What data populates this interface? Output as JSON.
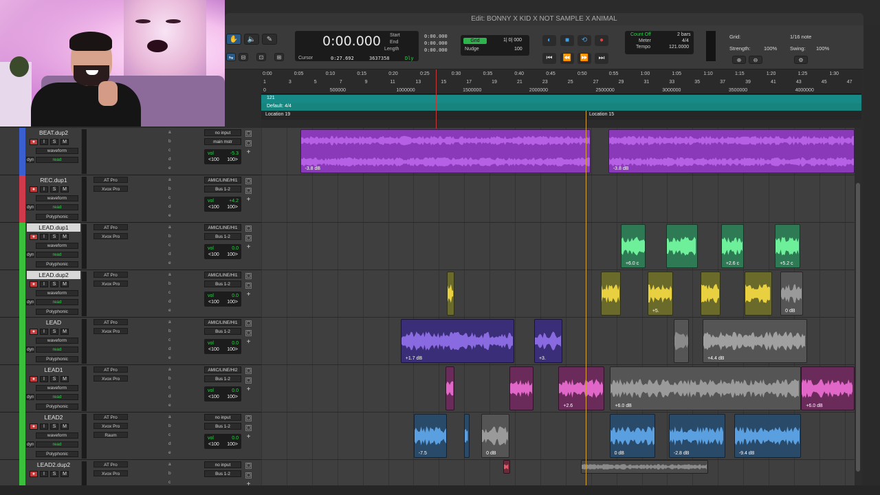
{
  "window": {
    "title": "Edit: BONNY X KID X NOT SAMPLE X ANIMAL"
  },
  "counter": {
    "main": "0:00.000",
    "cursor_label": "Cursor",
    "cursor_val": "0:27.692",
    "samples": "3637358",
    "dly": "Dly",
    "start_label": "Start",
    "end_label": "End",
    "length_label": "Length",
    "start": "0:00.000",
    "end": "0:00.000",
    "length": "0:00.000"
  },
  "grid_nudge": {
    "grid_label": "Grid",
    "grid_val": "1| 0| 000",
    "nudge_label": "Nudge",
    "nudge_val": "100"
  },
  "tempo": {
    "count_off": "Count Off",
    "meter_label": "Meter",
    "tempo_label": "Tempo",
    "bars": "2 bars",
    "meter": "4/4",
    "tempo": "121.0000"
  },
  "gridpanel": {
    "grid_label": "Grid:",
    "grid_val": "1/16 note",
    "strength_label": "Strength:",
    "strength": "100%",
    "swing_label": "Swing:",
    "swing": "100%"
  },
  "ruler": {
    "times": [
      "0:00",
      "0:05",
      "0:10",
      "0:15",
      "0:20",
      "0:25",
      "0:30",
      "0:35",
      "0:40",
      "0:45",
      "0:50",
      "0:55",
      "1:00",
      "1:05",
      "1:10",
      "1:15",
      "1:20",
      "1:25",
      "1:30"
    ],
    "bars": [
      "1",
      "3",
      "5",
      "7",
      "9",
      "11",
      "13",
      "15",
      "17",
      "19",
      "21",
      "23",
      "25",
      "27",
      "29",
      "31",
      "33",
      "35",
      "37",
      "39",
      "41",
      "43",
      "45",
      "47"
    ],
    "samples": [
      "0",
      "500000",
      "1000000",
      "1500000",
      "2000000",
      "2500000",
      "3000000",
      "3500000",
      "4000000"
    ],
    "tempo_marker": "121",
    "meter_marker": "Default: 4/4",
    "marker1": "Location 19",
    "marker2": "Location 15"
  },
  "tracks": [
    {
      "name": "BEAT.dup2",
      "color": "#3a5fd0",
      "in1": "",
      "in2": "",
      "io1": "no input",
      "io2": "main mstr",
      "vol": "-5.3",
      "pan1": "<100",
      "pan2": "100>",
      "mode": "waveform",
      "dyn": "dyn",
      "read": "read",
      "extra": ""
    },
    {
      "name": "REC.dup1",
      "color": "#d03a4a",
      "in1": "AT Pro",
      "in2": "Xvox Pro",
      "io1": "AMIC/LINE/HI1",
      "io2": "Bus 1-2",
      "vol": "+4.2",
      "pan1": "<100",
      "pan2": "100>",
      "mode": "waveform",
      "dyn": "dyn",
      "read": "read",
      "extra": "Polyphonic"
    },
    {
      "name": "LEAD.dup1",
      "color": "#3bc03b",
      "in1": "AT Pro",
      "in2": "Xvox Pro",
      "io1": "AMIC/LINE/HI1",
      "io2": "Bus 1-2",
      "vol": "0.0",
      "pan1": "<100",
      "pan2": "100>",
      "mode": "waveform",
      "dyn": "dyn",
      "read": "read",
      "extra": "Polyphonic"
    },
    {
      "name": "LEAD.dup2",
      "color": "#3bc03b",
      "in1": "AT Pro",
      "in2": "Xvox Pro",
      "io1": "AMIC/LINE/HI1",
      "io2": "Bus 1-2",
      "vol": "0.0",
      "pan1": "<100",
      "pan2": "100>",
      "mode": "waveform",
      "dyn": "dyn",
      "read": "read",
      "extra": "Polyphonic"
    },
    {
      "name": "LEAD",
      "color": "#3bc03b",
      "in1": "AT Pro",
      "in2": "Xvox Pro",
      "io1": "AMIC/LINE/HI1",
      "io2": "Bus 1-2",
      "vol": "0.0",
      "pan1": "<100",
      "pan2": "100>",
      "mode": "waveform",
      "dyn": "dyn",
      "read": "read",
      "extra": "Polyphonic"
    },
    {
      "name": "LEAD1",
      "color": "#3bc03b",
      "in1": "AT Pro",
      "in2": "Xvox Pro",
      "io1": "AMIC/LINE/HI2",
      "io2": "Bus 1-2",
      "vol": "0.0",
      "pan1": "<100",
      "pan2": "100>",
      "mode": "waveform",
      "dyn": "dyn",
      "read": "read",
      "extra": "Polyphonic"
    },
    {
      "name": "LEAD2",
      "color": "#3bc03b",
      "in1": "AT Pro",
      "in2": "Xvox Pro",
      "in3": "Raum",
      "io1": "no input",
      "io2": "Bus 1-2",
      "vol": "0.0",
      "pan1": "<100",
      "pan2": "100>",
      "mode": "waveform",
      "dyn": "dyn",
      "read": "read",
      "extra": "Polyphonic"
    },
    {
      "name": "LEAD2.dup2",
      "color": "#3bc03b",
      "in1": "AT Pro",
      "in2": "Xvox Pro",
      "io1": "no input",
      "io2": "Bus 1-2",
      "vol": "",
      "pan1": "",
      "pan2": "",
      "mode": "",
      "dyn": "",
      "read": "",
      "extra": ""
    }
  ],
  "sends": [
    "a",
    "b",
    "c",
    "d",
    "e"
  ],
  "vol_label": "vol",
  "clips": [
    {
      "lane": 0,
      "clips": [
        {
          "s": 0.0655,
          "e": 0.555,
          "c": "#8a3ab8",
          "w": "#b660e6",
          "label": "-3.8 dB"
        },
        {
          "s": 0.585,
          "e": 1.0,
          "c": "#8a3ab8",
          "w": "#b660e6",
          "label": "-3.8 dB"
        }
      ]
    },
    {
      "lane": 2,
      "clips": [
        {
          "s": 0.606,
          "e": 0.648,
          "c": "#2e7a55",
          "w": "#6ef09a",
          "label": "+6.0 c"
        },
        {
          "s": 0.683,
          "e": 0.736,
          "c": "#2e7a55",
          "w": "#6ef09a",
          "label": ""
        },
        {
          "s": 0.775,
          "e": 0.813,
          "c": "#2e7a55",
          "w": "#6ef09a",
          "label": "+2.6 c"
        },
        {
          "s": 0.866,
          "e": 0.908,
          "c": "#2e7a55",
          "w": "#6ef09a",
          "label": "+5.2 c"
        }
      ]
    },
    {
      "lane": 3,
      "clips": [
        {
          "s": 0.313,
          "e": 0.326,
          "c": "#6a6a2a",
          "w": "#e8d040",
          "label": ""
        },
        {
          "s": 0.573,
          "e": 0.606,
          "c": "#6a6a2a",
          "w": "#e8d040",
          "label": ""
        },
        {
          "s": 0.651,
          "e": 0.694,
          "c": "#6a6a2a",
          "w": "#e8d040",
          "label": "+5."
        },
        {
          "s": 0.741,
          "e": 0.774,
          "c": "#6a6a2a",
          "w": "#e8d040",
          "label": ""
        },
        {
          "s": 0.815,
          "e": 0.861,
          "c": "#6a6a2a",
          "w": "#e8d040",
          "label": ""
        },
        {
          "s": 0.875,
          "e": 0.913,
          "c": "#555555",
          "w": "#9a9a9a",
          "label": "0 dB"
        }
      ]
    },
    {
      "lane": 4,
      "clips": [
        {
          "s": 0.235,
          "e": 0.427,
          "c": "#3a2e78",
          "w": "#8a6ae0",
          "label": "+1.7 dB"
        },
        {
          "s": 0.46,
          "e": 0.508,
          "c": "#3a2e78",
          "w": "#8a6ae0",
          "label": "+3."
        },
        {
          "s": 0.695,
          "e": 0.721,
          "c": "#555555",
          "w": "#8a8a8a",
          "label": ""
        },
        {
          "s": 0.744,
          "e": 0.92,
          "c": "#555555",
          "w": "#a0a0a0",
          "label": "+4.4 dB"
        }
      ]
    },
    {
      "lane": 5,
      "clips": [
        {
          "s": 0.31,
          "e": 0.326,
          "c": "#6a2a5a",
          "w": "#e066c8",
          "label": ""
        },
        {
          "s": 0.418,
          "e": 0.459,
          "c": "#6a2a5a",
          "w": "#e066c8",
          "label": ""
        },
        {
          "s": 0.501,
          "e": 0.578,
          "c": "#6a2a5a",
          "w": "#e066c8",
          "label": "+2.6"
        },
        {
          "s": 0.588,
          "e": 0.91,
          "c": "#555555",
          "w": "#9a9a9a",
          "label": "+6.0 dB"
        },
        {
          "s": 0.91,
          "e": 1.0,
          "c": "#6a2a5a",
          "w": "#e066c8",
          "label": "+6.0 dB"
        }
      ]
    },
    {
      "lane": 6,
      "clips": [
        {
          "s": 0.257,
          "e": 0.313,
          "c": "#2a4a6a",
          "w": "#5aa0e0",
          "label": "-7.5"
        },
        {
          "s": 0.342,
          "e": 0.351,
          "c": "#2a4a6a",
          "w": "#5aa0e0",
          "label": ""
        },
        {
          "s": 0.371,
          "e": 0.418,
          "c": "#555555",
          "w": "#9a9a9a",
          "label": "0 dB"
        },
        {
          "s": 0.587,
          "e": 0.664,
          "c": "#2a4a6a",
          "w": "#5aa0e0",
          "label": "0 dB"
        },
        {
          "s": 0.687,
          "e": 0.782,
          "c": "#2a4a6a",
          "w": "#5aa0e0",
          "label": "-2.8 dB"
        },
        {
          "s": 0.797,
          "e": 0.91,
          "c": "#2a4a6a",
          "w": "#5aa0e0",
          "label": "-9.4 dB"
        }
      ]
    },
    {
      "lane": 7,
      "clips": [
        {
          "s": 0.408,
          "e": 0.419,
          "c": "#6a2a3a",
          "w": "#e05a6a",
          "label": ""
        },
        {
          "s": 0.539,
          "e": 0.753,
          "c": "#4a4a4a",
          "w": "#8a8a8a",
          "label": ""
        }
      ]
    }
  ]
}
